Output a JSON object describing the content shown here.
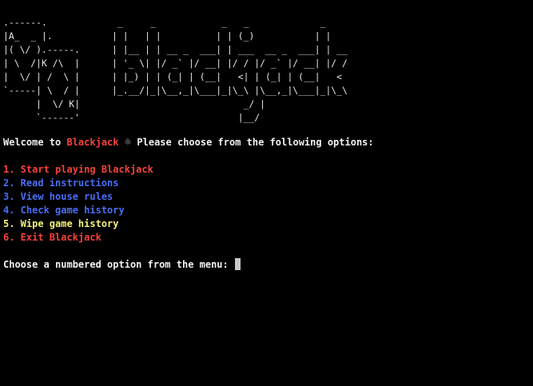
{
  "banner": {
    "card_lines": [
      ".------.",
      "|A_  _ |.",
      "|( \\/ ).-----.",
      "| \\  /|K /\\  |",
      "|  \\/ | /  \\ |",
      "`-----| \\  / |",
      "      |  \\/ K|",
      "      `------'"
    ],
    "word_lines": [
      "_     _            _   _             _",
      "| |   | |          | | (_)           | |",
      "| |__ | | __ _  ___| | ___  __ _  ___| | __",
      "| '_ \\| |/ _` |/ __| |/ / |/ _` |/ __| |/ /",
      "| |_) | | (_| | (__|   <| | (_| | (__|   <",
      "|_.__/|_|\\__,_|\\___|_|\\_\\ |\\__,_|\\___|_|\\_\\",
      "                        _/ |",
      "                       |__/"
    ]
  },
  "welcome": {
    "before": "Welcome to ",
    "highlight": "Blackjack",
    "icon": "spade-icon",
    "after": " Please choose from the following options:"
  },
  "menu": [
    {
      "label": "1. Start playing Blackjack",
      "color": "#f4433b"
    },
    {
      "label": "2. Read instructions",
      "color": "#4a6ef5"
    },
    {
      "label": "3. View house rules",
      "color": "#4a6ef5"
    },
    {
      "label": "4. Check game history",
      "color": "#4a6ef5"
    },
    {
      "label": "5. Wipe game history",
      "color": "#f4f07a"
    },
    {
      "label": "6. Exit Blackjack",
      "color": "#f4433b"
    }
  ],
  "prompt": {
    "text": "Choose a numbered option from the menu: "
  },
  "colors": {
    "background": "#000000",
    "text": "#f2f2f2",
    "accent_red": "#f4433b",
    "accent_blue": "#4a6ef5",
    "accent_yellow": "#f4f07a"
  }
}
